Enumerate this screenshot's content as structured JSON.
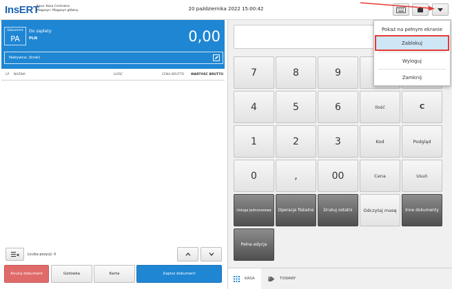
{
  "header": {
    "logo": "InsERT",
    "store_line1": "Kasa: Kasa Centralna",
    "store_line2": "Magazyn: Magazyn główny",
    "datetime": "20 października 2022 15:00:42"
  },
  "document": {
    "type_label": "Dokument",
    "type_code": "PA",
    "pay_label": "Do zapłaty:",
    "currency": "PLN",
    "amount": "0,00",
    "buyer": "Nabywca: (brak)"
  },
  "columns": {
    "lp": "LP",
    "name": "NAZWA",
    "qty": "ILOŚĆ",
    "price": "CENA BRUTTO",
    "value": "WARTOŚĆ BRUTTO"
  },
  "bottom": {
    "positions": "Liczba pozycji: 0",
    "cancel": "Anuluj dokument",
    "cash": "Gotówka",
    "card": "Karta",
    "save": "Zapisz dokument"
  },
  "keypad": {
    "k7": "7",
    "k8": "8",
    "k9": "9",
    "k4": "4",
    "k5": "5",
    "k6": "6",
    "k1": "1",
    "k2": "2",
    "k3": "3",
    "k0": "0",
    "comma": ",",
    "k00": "00",
    "qty": "Ilość",
    "c": "C",
    "code": "Kod",
    "preview": "Podgląd",
    "price": "Cena",
    "delete": "Usuń",
    "one_time": "Usługa jednorazowa",
    "fiscal": "Operacje fiskalne",
    "print_last": "Drukuj ostatni",
    "read_weight": "Odczytaj masę",
    "other_docs": "Inne dokumenty",
    "full_edit": "Pełna edycja"
  },
  "tabs": {
    "kasa": "KASA",
    "towary": "TOWARY"
  },
  "menu": {
    "fullscreen": "Pokaż na pełnym ekranie",
    "lock": "Zablokuj",
    "logout": "Wyloguj",
    "close": "Zamknij"
  },
  "colors": {
    "accent_blue": "#1f86d3",
    "cancel_red": "#e06a6a",
    "highlight_border": "#e53935"
  }
}
